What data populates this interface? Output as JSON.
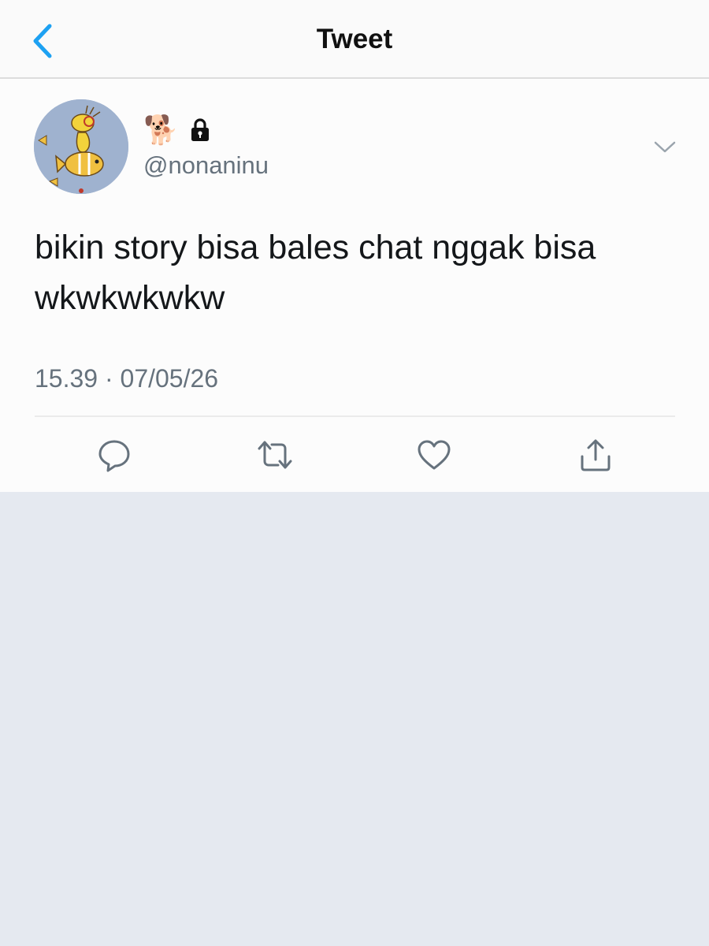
{
  "header": {
    "title": "Tweet",
    "back_icon": "chevron-left-icon",
    "accent_color": "#1da1f2"
  },
  "tweet": {
    "display_name_emoji": "🐕",
    "protected_icon": "lock-icon",
    "handle": "@nonaninu",
    "text": "bikin story bisa bales chat nggak bisa wkwkwkwkw",
    "timestamp": "15.39 · 07/05/26",
    "more_icon": "chevron-down-icon"
  },
  "actions": [
    {
      "name": "reply",
      "icon": "reply-icon"
    },
    {
      "name": "retweet",
      "icon": "retweet-icon"
    },
    {
      "name": "like",
      "icon": "heart-icon"
    },
    {
      "name": "share",
      "icon": "share-icon"
    }
  ],
  "colors": {
    "text_primary": "#14171a",
    "text_secondary": "#66727d",
    "background_lower": "#e5e9f0"
  }
}
